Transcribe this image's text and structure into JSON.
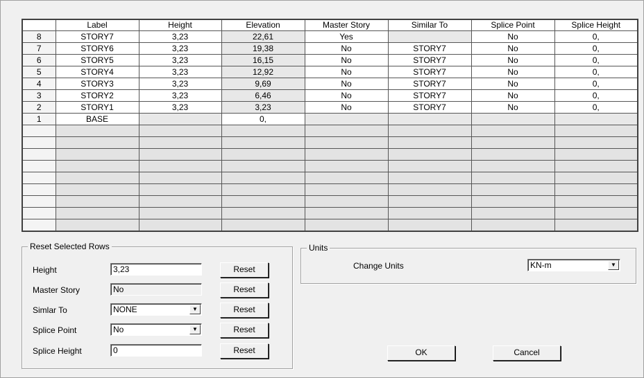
{
  "grid": {
    "columns": [
      "",
      "Label",
      "Height",
      "Elevation",
      "Master Story",
      "Similar To",
      "Splice Point",
      "Splice Height"
    ],
    "rows": [
      [
        "8",
        "STORY7",
        "3,23",
        "22,61",
        "Yes",
        "",
        "No",
        "0,"
      ],
      [
        "7",
        "STORY6",
        "3,23",
        "19,38",
        "No",
        "STORY7",
        "No",
        "0,"
      ],
      [
        "6",
        "STORY5",
        "3,23",
        "16,15",
        "No",
        "STORY7",
        "No",
        "0,"
      ],
      [
        "5",
        "STORY4",
        "3,23",
        "12,92",
        "No",
        "STORY7",
        "No",
        "0,"
      ],
      [
        "4",
        "STORY3",
        "3,23",
        "9,69",
        "No",
        "STORY7",
        "No",
        "0,"
      ],
      [
        "3",
        "STORY2",
        "3,23",
        "6,46",
        "No",
        "STORY7",
        "No",
        "0,"
      ],
      [
        "2",
        "STORY1",
        "3,23",
        "3,23",
        "No",
        "STORY7",
        "No",
        "0,"
      ],
      [
        "1",
        "BASE",
        "",
        "0,",
        "",
        "",
        "",
        ""
      ]
    ],
    "empty_row_count": 9
  },
  "reset_group": {
    "title": "Reset Selected Rows",
    "height_label": "Height",
    "height_value": "3,23",
    "master_story_label": "Master Story",
    "master_story_value": "No",
    "similar_to_label": "Simlar To",
    "similar_to_value": "NONE",
    "splice_point_label": "Splice Point",
    "splice_point_value": "No",
    "splice_height_label": "Splice Height",
    "splice_height_value": "0",
    "reset_label": "Reset"
  },
  "units_group": {
    "title": "Units",
    "change_units_label": "Change Units",
    "units_value": "KN-m"
  },
  "buttons": {
    "ok": "OK",
    "cancel": "Cancel"
  }
}
